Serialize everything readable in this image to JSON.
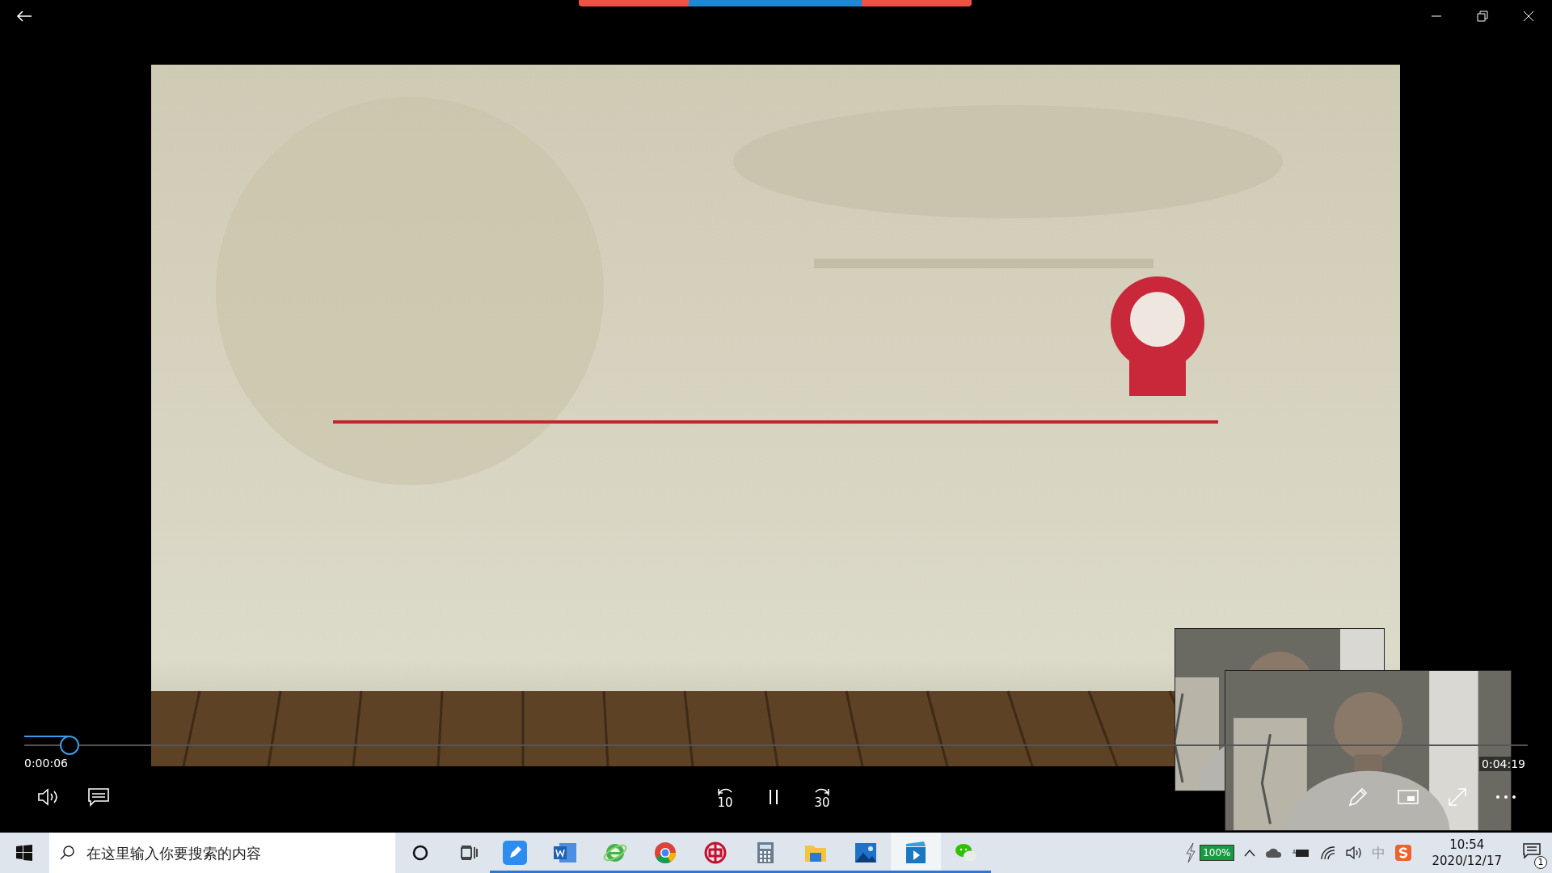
{
  "player": {
    "playing": true,
    "elapsed": "0:00:06",
    "duration": "0:04:19",
    "progress": {
      "level": 0.03
    },
    "rewind": "10",
    "forward": "30"
  },
  "taskbar": {
    "search_placeholder": "在这里输入你要搜索的内容",
    "apps": [
      {
        "kind": "pen",
        "running": true,
        "selected": false
      },
      {
        "kind": "word",
        "running": true,
        "selected": false
      },
      {
        "kind": "ie",
        "running": true,
        "selected": false
      },
      {
        "kind": "chrome",
        "running": true,
        "selected": false
      },
      {
        "kind": "bank",
        "running": true,
        "selected": false
      },
      {
        "kind": "calculator",
        "running": true,
        "selected": false
      },
      {
        "kind": "folder",
        "running": true,
        "selected": false
      },
      {
        "kind": "photos",
        "running": true,
        "selected": false
      },
      {
        "kind": "player",
        "running": true,
        "selected": true
      },
      {
        "kind": "chat",
        "running": true,
        "selected": false
      }
    ],
    "battery": "100%",
    "ime": "中",
    "time": "10:54",
    "date": "2020/12/17",
    "notifications": "1"
  }
}
